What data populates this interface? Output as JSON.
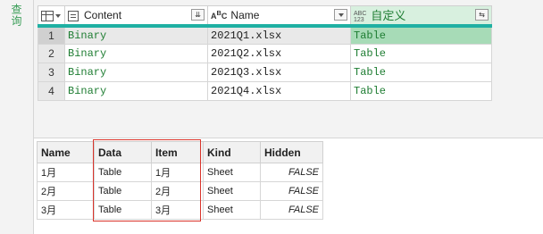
{
  "sidebar": {
    "label": "查询"
  },
  "grid": {
    "headers": {
      "content": "Content",
      "name": "Name",
      "custom": "自定义",
      "abc_type": "ABC",
      "num_type": "123"
    },
    "rows": [
      {
        "num": "1",
        "content": "Binary",
        "name": "2021Q1.xlsx",
        "custom": "Table"
      },
      {
        "num": "2",
        "content": "Binary",
        "name": "2021Q2.xlsx",
        "custom": "Table"
      },
      {
        "num": "3",
        "content": "Binary",
        "name": "2021Q3.xlsx",
        "custom": "Table"
      },
      {
        "num": "4",
        "content": "Binary",
        "name": "2021Q4.xlsx",
        "custom": "Table"
      }
    ]
  },
  "preview": {
    "headers": {
      "name": "Name",
      "data": "Data",
      "item": "Item",
      "kind": "Kind",
      "hidden": "Hidden"
    },
    "rows": [
      {
        "name": "1月",
        "data": "Table",
        "item": "1月",
        "kind": "Sheet",
        "hidden": "FALSE"
      },
      {
        "name": "2月",
        "data": "Table",
        "item": "2月",
        "kind": "Sheet",
        "hidden": "FALSE"
      },
      {
        "name": "3月",
        "data": "Table",
        "item": "3月",
        "kind": "Sheet",
        "hidden": "FALSE"
      }
    ]
  },
  "colors": {
    "accent_green": "#1e7d32",
    "header_underline": "#1fb0a3",
    "selected_cell": "#a7dbb7",
    "highlight_box": "#d9342b"
  }
}
